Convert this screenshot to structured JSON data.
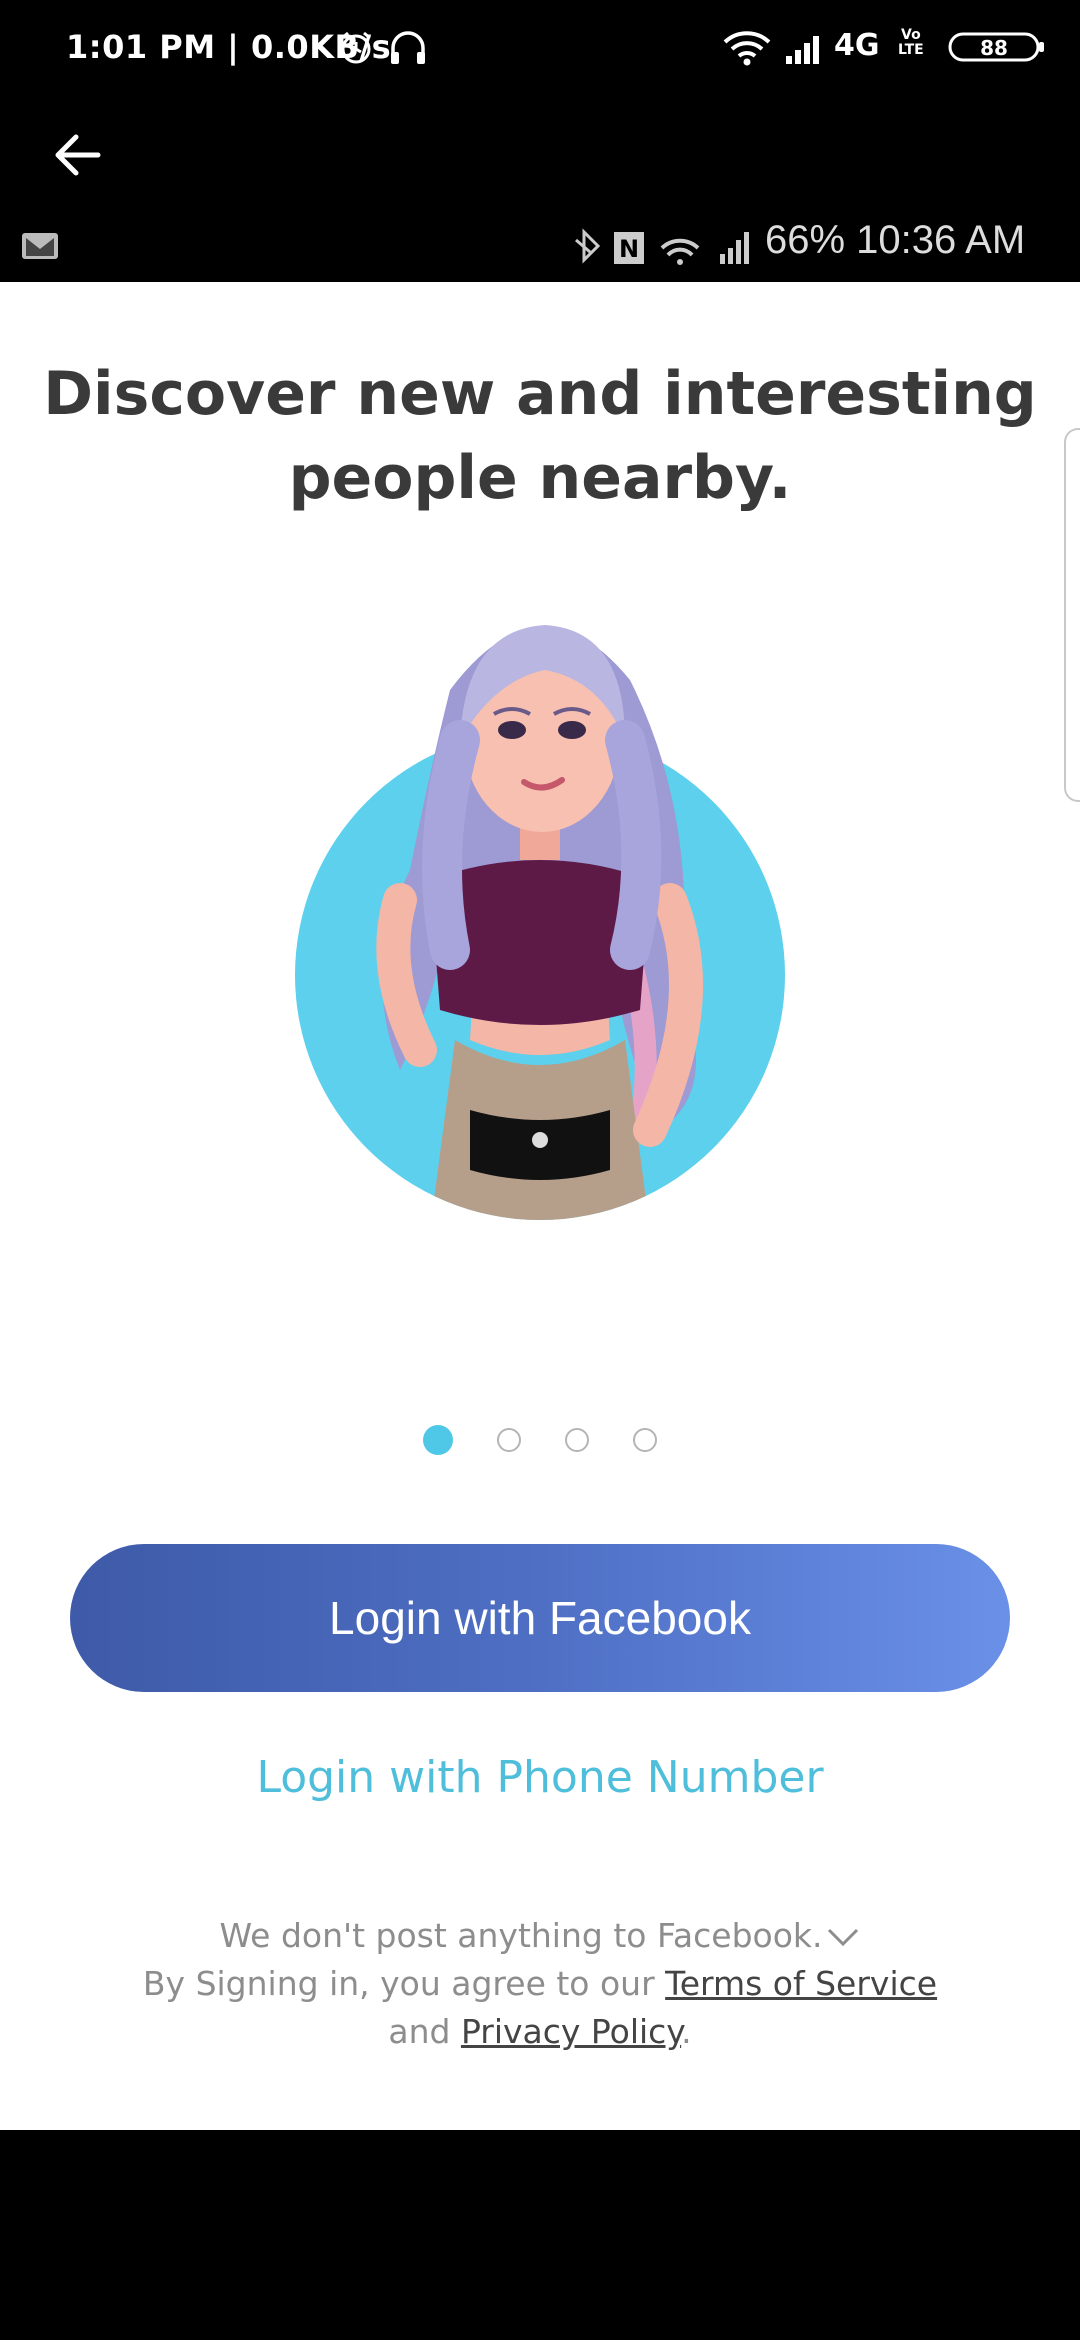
{
  "outer_status": {
    "time": "1:01 PM | 0.0KB/s",
    "network": "4G",
    "volte_top": "Vo",
    "volte_bottom": "LTE",
    "battery": "88"
  },
  "inner_status": {
    "text": "66%  10:36 AM"
  },
  "onboarding": {
    "headline": "Discover new and interesting people nearby.",
    "pages": 4,
    "active_page": 1
  },
  "actions": {
    "facebook_login": "Login with Facebook",
    "phone_login": "Login with Phone Number"
  },
  "footer": {
    "line1": "We don't post anything to Facebook.",
    "line2_prefix": "By Signing in, you agree to our ",
    "terms": "Terms of Service",
    "line3_prefix": "and ",
    "privacy": "Privacy Policy",
    "line3_suffix": "."
  },
  "colors": {
    "accent": "#4ec8e6",
    "facebook_start": "#3e5aa8",
    "facebook_end": "#6a90e8",
    "link": "#4fbedb"
  }
}
